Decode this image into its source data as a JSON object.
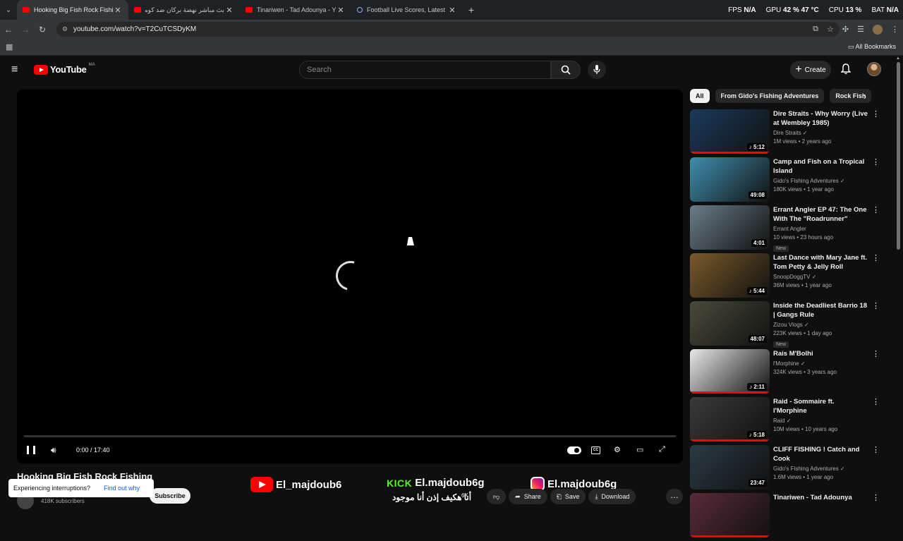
{
  "browser": {
    "tabs": [
      {
        "title": "Hooking Big Fish Rock Fishing",
        "active": true,
        "favicon": "youtube-icon"
      },
      {
        "title": "بث مباشر نهضة بركان ضد كومو",
        "active": false,
        "favicon": "youtube-icon"
      },
      {
        "title": "Tinariwen - Tad Adounya - You",
        "active": false,
        "favicon": "youtube-icon"
      },
      {
        "title": "Football Live Scores, Latest Foo",
        "active": false,
        "favicon": "globe-icon"
      }
    ],
    "url": "youtube.com/watch?v=T2CuTCSDyKM",
    "system": {
      "fps_label": "FPS",
      "fps_value": "N/A",
      "gpu_label": "GPU",
      "gpu_value": "42 % 47 °C",
      "cpu_label": "CPU",
      "cpu_value": "13 %",
      "bat_label": "BAT",
      "bat_value": "N/A"
    },
    "bookmarks_label": "All Bookmarks"
  },
  "youtube": {
    "logo_text": "YouTube",
    "country_code": "MA",
    "search_placeholder": "Search",
    "create_label": "Create"
  },
  "player": {
    "time": "0:00 / 17:40",
    "state": "loading",
    "progress": 0
  },
  "video": {
    "title": "Hooking Big Fish Rock Fishing",
    "subscribers": "418K subscribers",
    "subscribe_label": "Subscribe",
    "likes": "6K",
    "share_label": "Share",
    "save_label": "Save",
    "download_label": "Download"
  },
  "popup": {
    "text": "Experiencing interruptions?",
    "link": "Find out why"
  },
  "overlay": {
    "youtube_handle": "El_majdoub6",
    "kick_label": "KICK",
    "kick_handle": "El.majdoub6g",
    "instagram_handle": "El.majdoub6g",
    "arabic_caption": "أنا هكيف إذن أنا موجود"
  },
  "chips": [
    "All",
    "From Gido's Fishing Adventures",
    "Rock Fish"
  ],
  "recommendations": [
    {
      "title": "Dire Straits - Why Worry (Live at Wembley 1985)",
      "channel": "Dire Straits",
      "verified": true,
      "meta": "1M views • 2 years ago",
      "duration": "5:12",
      "music": true,
      "isnew": "",
      "thumb": "#1a3a5c",
      "watched": 1.0
    },
    {
      "title": "Camp and Fish on a Tropical Island",
      "channel": "Gido's Fishing Adventures",
      "verified": true,
      "meta": "180K views • 1 year ago",
      "duration": "49:08",
      "music": false,
      "isnew": "",
      "thumb": "#3f8fb0",
      "watched": 0
    },
    {
      "title": "Errant Angler EP 47: The One With The \"Roadrunner\"",
      "channel": "Errant Angler",
      "verified": false,
      "meta": "10 views • 23 hours ago",
      "duration": "4:01",
      "music": false,
      "isnew": "New",
      "thumb": "#6a7d8a",
      "watched": 0
    },
    {
      "title": "Last Dance with Mary Jane ft. Tom Petty & Jelly Roll (Official...",
      "channel": "SnoopDoggTV",
      "verified": true,
      "meta": "36M views • 1 year ago",
      "duration": "5:44",
      "music": true,
      "isnew": "",
      "thumb": "#7a5a2a",
      "watched": 0
    },
    {
      "title": "Inside the Deadliest Barrio 18 | Gangs Rule",
      "channel": "Zizou Vlogs",
      "verified": true,
      "meta": "223K views • 1 day ago",
      "duration": "48:07",
      "music": false,
      "isnew": "New",
      "thumb": "#4a4a3a",
      "watched": 0
    },
    {
      "title": "Rais M'Bolhi",
      "channel": "l'Morphine",
      "verified": true,
      "meta": "324K views • 3 years ago",
      "duration": "2:11",
      "music": true,
      "isnew": "",
      "thumb": "#e8e8e8",
      "watched": 1.0
    },
    {
      "title": "Raid - Sommaire ft. l'Morphine",
      "channel": "Raid",
      "verified": true,
      "meta": "10M views • 10 years ago",
      "duration": "5:18",
      "music": true,
      "isnew": "",
      "thumb": "#3a3a3a",
      "watched": 1.0
    },
    {
      "title": "CLIFF FISHING ! Catch and Cook",
      "channel": "Gido's Fishing Adventures",
      "verified": true,
      "meta": "1.6M views • 1 year ago",
      "duration": "23:47",
      "music": false,
      "isnew": "",
      "thumb": "#2a3a44",
      "watched": 0
    },
    {
      "title": "Tinariwen - Tad Adounya",
      "channel": "",
      "verified": false,
      "meta": "",
      "duration": "",
      "music": false,
      "isnew": "",
      "thumb": "#5a2a3a",
      "watched": 1.0
    }
  ]
}
